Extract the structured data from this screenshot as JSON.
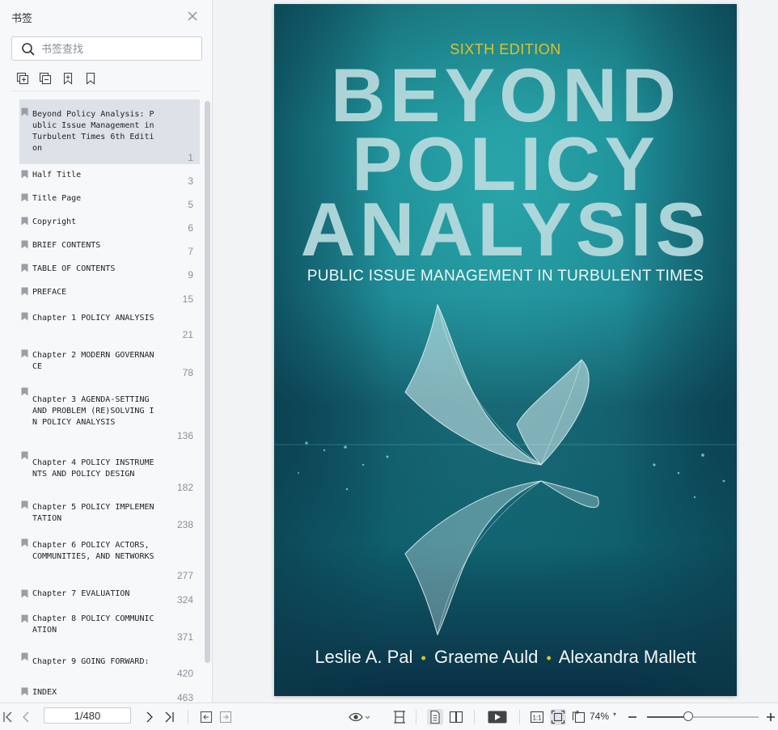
{
  "sidebar": {
    "title": "书签",
    "search_placeholder": "书签查找",
    "tools": [
      "expand-all-icon",
      "collapse-all-icon",
      "add-bookmark-icon",
      "bookmark-icon"
    ],
    "bookmarks": [
      {
        "label": "Beyond Policy Analysis: Public Issue Management in Turbulent Times 6th Edition",
        "page": "1",
        "selected": true
      },
      {
        "label": "Half Title",
        "page": "3"
      },
      {
        "label": "Title Page",
        "page": "5"
      },
      {
        "label": "Copyright",
        "page": "6"
      },
      {
        "label": "BRIEF CONTENTS",
        "page": "7"
      },
      {
        "label": "TABLE OF CONTENTS",
        "page": "9"
      },
      {
        "label": "PREFACE",
        "page": "15"
      },
      {
        "label": "Chapter 1 POLICY ANALYSIS",
        "page": "21"
      },
      {
        "label": "Chapter 2 MODERN GOVERNANCE",
        "page": "78"
      },
      {
        "label": "Chapter 3 AGENDA-SETTING AND PROBLEM (RE)SOLVING IN POLICY ANALYSIS",
        "page": "136"
      },
      {
        "label": "Chapter 4 POLICY INSTRUMENTS AND POLICY DESIGN",
        "page": "182"
      },
      {
        "label": "Chapter 5 POLICY IMPLEMENTATION",
        "page": "238"
      },
      {
        "label": "Chapter 6 POLICY ACTORS, COMMUNITIES, AND NETWORKS",
        "page": "277"
      },
      {
        "label": "Chapter 7 EVALUATION",
        "page": "324"
      },
      {
        "label": "Chapter 8 POLICY COMMUNICATION",
        "page": "371"
      },
      {
        "label": "Chapter 9 GOING FORWARD:",
        "page": "420"
      },
      {
        "label": "INDEX",
        "page": "463"
      }
    ]
  },
  "cover": {
    "edition": "SIXTH EDITION",
    "title_line1": "BEYOND",
    "title_line2": "POLICY",
    "title_line3": "ANALYSIS",
    "subtitle": "PUBLIC ISSUE MANAGEMENT IN TURBULENT TIMES",
    "author1": "Leslie A. Pal",
    "author2": "Graeme Auld",
    "author3": "Alexandra Mallett",
    "separator": "•"
  },
  "toolbar": {
    "page_indicator": "1/480",
    "zoom": "74%",
    "zoom_fraction": 0.37,
    "zoom_caret": "▾"
  }
}
